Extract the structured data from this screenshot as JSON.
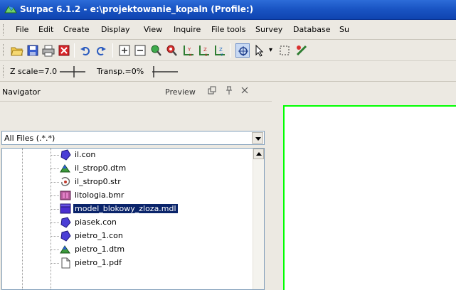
{
  "window": {
    "title": "Surpac 6.1.2 - e:\\projektowanie_kopaln (Profile:)"
  },
  "menu": [
    "File",
    "Edit",
    "Create",
    "Display",
    "View",
    "Inquire",
    "File tools",
    "Survey",
    "Database",
    "Su"
  ],
  "toolbar": {
    "icons": [
      "open-folder-icon",
      "save-icon",
      "print-icon",
      "properties-icon",
      "undo-icon",
      "redo-icon",
      "zoom-box-in-icon",
      "zoom-box-out-icon",
      "zoom-in-icon",
      "zoom-out-icon",
      "view-xz-icon",
      "view-zx-icon",
      "view-zy-icon",
      "select-point-icon",
      "cursor-icon",
      "select-rect-icon",
      "tools-icon"
    ]
  },
  "display_bar": {
    "z_scale": "Z scale=7.0",
    "transparency": "Transp.=0%"
  },
  "navigator": {
    "title": "Navigator",
    "preview_label": "Preview",
    "filter_value": "All Files (.*.*)",
    "files": [
      {
        "name": "il.con",
        "icon": "con-file-icon",
        "selected": false
      },
      {
        "name": "il_strop0.dtm",
        "icon": "dtm-file-icon",
        "selected": false
      },
      {
        "name": "il_strop0.str",
        "icon": "str-file-icon",
        "selected": false
      },
      {
        "name": "litologia.bmr",
        "icon": "bmr-file-icon",
        "selected": false
      },
      {
        "name": "model_blokowy_zloza.mdl",
        "icon": "mdl-file-icon",
        "selected": true
      },
      {
        "name": "piasek.con",
        "icon": "con-file-icon",
        "selected": false
      },
      {
        "name": "pietro_1.con",
        "icon": "con-file-icon",
        "selected": false
      },
      {
        "name": "pietro_1.dtm",
        "icon": "dtm-file-icon",
        "selected": false
      },
      {
        "name": "pietro_1.pdf",
        "icon": "pdf-file-icon",
        "selected": false
      }
    ]
  },
  "colors": {
    "title_bar": "#1a55c4",
    "chrome": "#ece9e2",
    "selection": "#0a246a",
    "viewport_border": "#00ff00"
  }
}
